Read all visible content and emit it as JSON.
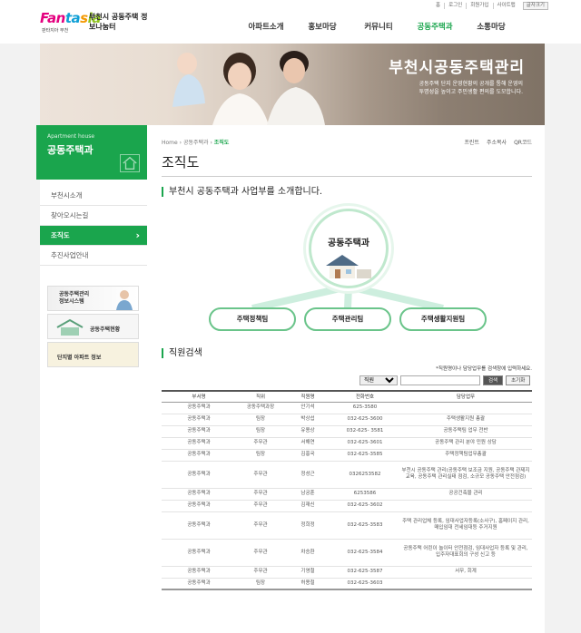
{
  "header": {
    "logo_text": "Fantasia",
    "logo_sub": "판타지아 부천",
    "site_name": "부천시 공동주택 정보나눔터",
    "utils": [
      "홈",
      "로그인",
      "회원가입",
      "사이트맵"
    ],
    "font_label": "글자크기"
  },
  "gnb": [
    {
      "label": "아파트소개",
      "active": false
    },
    {
      "label": "홍보마당",
      "active": false
    },
    {
      "label": "커뮤니티",
      "active": false
    },
    {
      "label": "공동주택과",
      "active": true
    },
    {
      "label": "소통마당",
      "active": false
    }
  ],
  "banner": {
    "title": "부천시공동주택관리",
    "desc": "공동주택 단지 운영현황의 공개를 통해 운영의 투명성을 높이고 주민생활 편의를 도모합니다."
  },
  "side": {
    "en_title": "Apartment house",
    "title": "공동주택과",
    "items": [
      {
        "label": "부천시소개",
        "active": false
      },
      {
        "label": "찾아오시는길",
        "active": false
      },
      {
        "label": "조직도",
        "active": true
      },
      {
        "label": "추진사업안내",
        "active": false
      }
    ],
    "quick1": "공동주택관리\n정보시스템",
    "quick2": "공동주택현황",
    "quick3": "단지별 아파트 정보"
  },
  "content": {
    "location": {
      "home": "Home",
      "parent": "공동주택과",
      "current": "조직도"
    },
    "tools": [
      "프린트",
      "주소복사",
      "QR코드"
    ],
    "title": "조직도",
    "intro": "부천시 공동주택과 사업부를 소개합니다.",
    "org_main": "공동주택과",
    "teams": [
      "주택정책팀",
      "주택관리팀",
      "주택생활지원팀"
    ],
    "search_title": "직원검색",
    "search_note": "*직원명이나 담당업무를 검색창에 입력하세요.",
    "search_select": "직원",
    "search_btn": "검색",
    "reset_btn": "초기화"
  },
  "table": {
    "headers": [
      "부서명",
      "직위",
      "직원명",
      "전화번호",
      "담당업무"
    ],
    "rows": [
      [
        "공동주택과",
        "공동주택과장",
        "안기석",
        "625-3580",
        ""
      ],
      [
        "공동주택과",
        "팀장",
        "박상섭",
        "032-625-3600",
        "주택생활지원 총괄"
      ],
      [
        "공동주택과",
        "팀장",
        "유용상",
        "032-625- 3581",
        "공동주택팀 업무 전반"
      ],
      [
        "공동주택과",
        "주무관",
        "서해연",
        "032-625-3601",
        "공동주택 관리 분야 민원 상담"
      ],
      [
        "공동주택과",
        "팀장",
        "김홍국",
        "032-625-3585",
        "주택정책팀업무총괄"
      ],
      [
        "공동주택과",
        "주무관",
        "정성근",
        "0326253582",
        "부천시 공동주택 관리(공동주택 보조금 지원, 공동주택 관제지 교육, 공동주택 관리실태 점검, 소규모 공동주택 안전점검)"
      ],
      [
        "공동주택과",
        "주무관",
        "남궁훈",
        "6253586",
        "공공건축물 관리"
      ],
      [
        "공동주택과",
        "주무관",
        "김재신",
        "032-625-3602",
        ""
      ],
      [
        "공동주택과",
        "주무관",
        "정희정",
        "032-625-3583",
        "주택 관리업체 등록, 임대사업자등록(소사구), 홈페이지 관리, 매입임대 전세임대등 주거지원"
      ],
      [
        "공동주택과",
        "주무관",
        "차승환",
        "032-625-3584",
        "공동주택 어린이 놀이터 안전점검, 임대사업자 등록 및 관리, 입주자대표회의 구성 신고 등"
      ],
      [
        "공동주택과",
        "주무관",
        "기영철",
        "032-625-3587",
        "서무, 회계"
      ],
      [
        "공동주택과",
        "팀장",
        "허용철",
        "032-625-3603",
        ""
      ]
    ]
  }
}
